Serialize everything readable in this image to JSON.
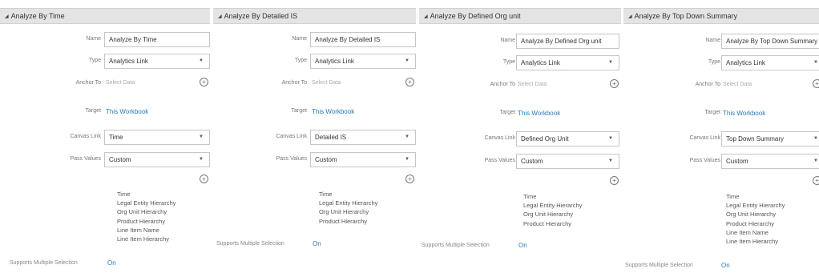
{
  "labels": {
    "name": "Name",
    "type": "Type",
    "anchor_to": "Anchor To",
    "target": "Target",
    "canvas_link": "Canvas Link",
    "pass_values": "Pass Values",
    "supports_multiple_selection": "Supports Multiple Selection"
  },
  "panels": [
    {
      "title": "Analyze By Time",
      "name": "Analyze By Time",
      "type": "Analytics Link",
      "anchor_placeholder": "Select Data",
      "target": "This Workbook",
      "canvas_link": "Time",
      "pass_values": "Custom",
      "values": [
        "Time",
        "Legal Entity Hierarchy",
        "Org Unit Hierarchy",
        "Product Hierarchy",
        "Line Item Name",
        "Line Item Hierarchy"
      ],
      "multi_select": "On"
    },
    {
      "title": "Analyze By Detailed IS",
      "name": "Analyze By Detailed IS",
      "type": "Analytics Link",
      "anchor_placeholder": "Select Data",
      "target": "This Workbook",
      "canvas_link": "Detailed IS",
      "pass_values": "Custom",
      "values": [
        "Time",
        "Legal Entity Hierarchy",
        "Org Unit Hierarchy",
        "Product Hierarchy"
      ],
      "multi_select": "On"
    },
    {
      "title": "Analyze By Defined Org unit",
      "name": "Analyze By Defined Org unit",
      "type": "Analytics Link",
      "anchor_placeholder": "Select Data",
      "target": "This Workbook",
      "canvas_link": "Defined Org Unit",
      "pass_values": "Custom",
      "values": [
        "Time",
        "Legal Entity Hierarchy",
        "Org Unit Hierarchy",
        "Product Hierarchy"
      ],
      "multi_select": "On"
    },
    {
      "title": "Analyze By Top Down Summary",
      "name": "Analyze By Top Down Summary",
      "type": "Analytics Link",
      "anchor_placeholder": "Select Data",
      "target": "This Workbook",
      "canvas_link": "Top Down Summary",
      "pass_values": "Custom",
      "values": [
        "Time",
        "Legal Entity Hierarchy",
        "Org Unit Hierarchy",
        "Product Hierarchy",
        "Line Item Name",
        "Line Item Hierarchy"
      ],
      "multi_select": "On"
    }
  ],
  "icons": {
    "collapse": "triangle-down-icon",
    "add": "plus-circle-icon",
    "dropdown": "chevron-down-icon"
  },
  "colors": {
    "link": "#2a7ab8",
    "header_bg": "#e4e4e4"
  }
}
